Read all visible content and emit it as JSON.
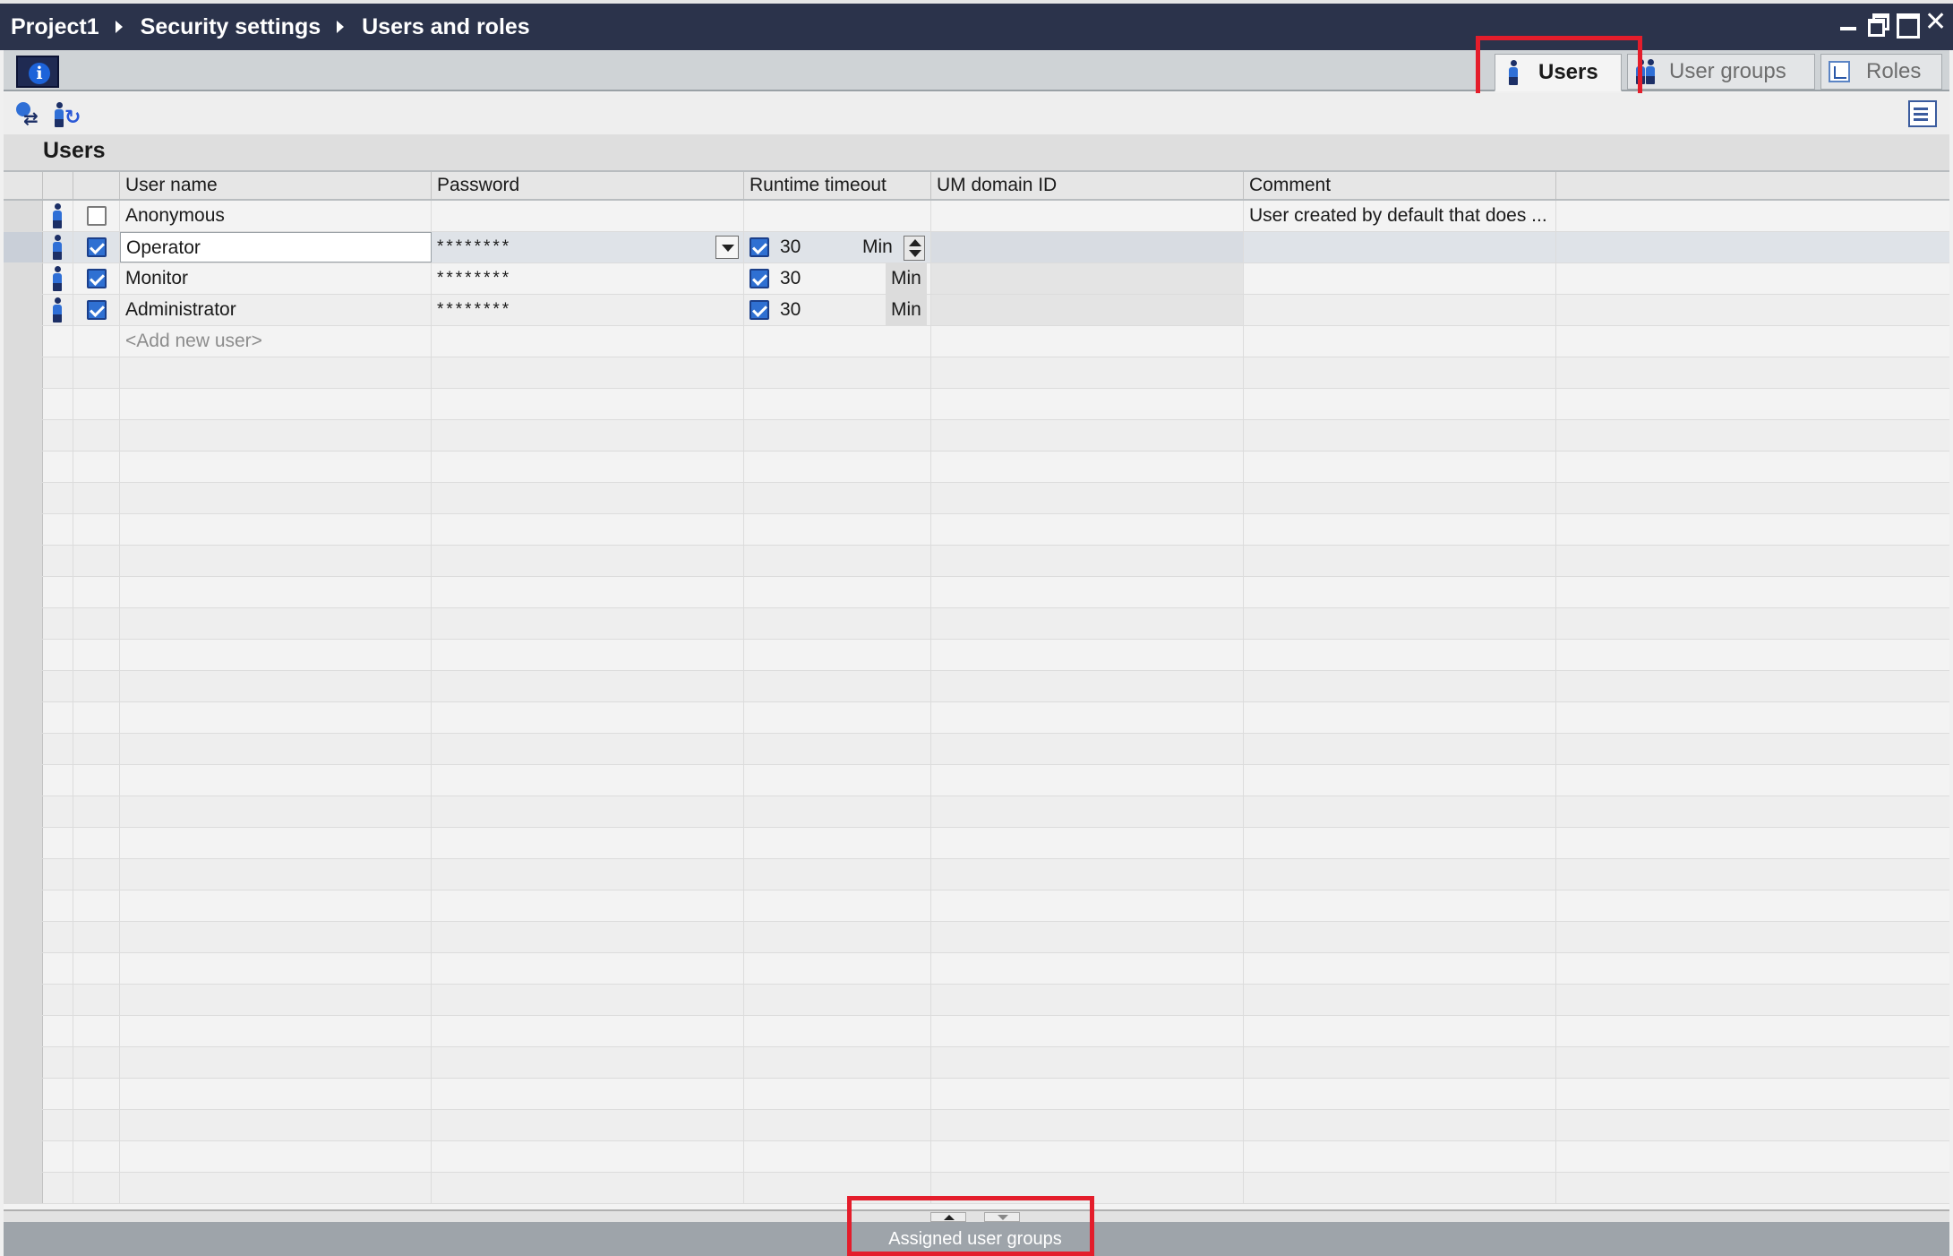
{
  "breadcrumb": [
    "Project1",
    "Security settings",
    "Users and roles"
  ],
  "tabs": [
    {
      "label": "Users",
      "active": true
    },
    {
      "label": "User groups",
      "active": false
    },
    {
      "label": "Roles",
      "active": false
    }
  ],
  "section": {
    "title": "Users"
  },
  "table": {
    "columns": [
      "User name",
      "Password",
      "Runtime timeout",
      "UM domain ID",
      "Comment"
    ],
    "rows": [
      {
        "name": "Anonymous",
        "enabled": false,
        "password": "",
        "timeout_enabled": null,
        "timeout": "",
        "unit": "",
        "domain_id": "",
        "comment": "User created by default that does ..."
      },
      {
        "name": "Operator",
        "enabled": true,
        "password": "********",
        "timeout_enabled": true,
        "timeout": "30",
        "unit": "Min",
        "domain_id": "",
        "comment": ""
      },
      {
        "name": "Monitor",
        "enabled": true,
        "password": "********",
        "timeout_enabled": true,
        "timeout": "30",
        "unit": "Min",
        "domain_id": "",
        "comment": ""
      },
      {
        "name": "Administrator",
        "enabled": true,
        "password": "********",
        "timeout_enabled": true,
        "timeout": "30",
        "unit": "Min",
        "domain_id": "",
        "comment": ""
      }
    ],
    "add_new_placeholder": "<Add new user>"
  },
  "bottom_panel": {
    "label": "Assigned user groups"
  },
  "icons": {
    "info": "info-icon",
    "user": "user-icon",
    "user_group": "user-group-icon",
    "roles": "roles-icon",
    "sync": "sync-icon",
    "user_sync": "user-sync-icon",
    "view_settings": "view-settings-icon"
  },
  "colors": {
    "titlebar": "#2b334b",
    "highlight": "#e41d2b",
    "checkbox_checked": "#2f70d2"
  }
}
